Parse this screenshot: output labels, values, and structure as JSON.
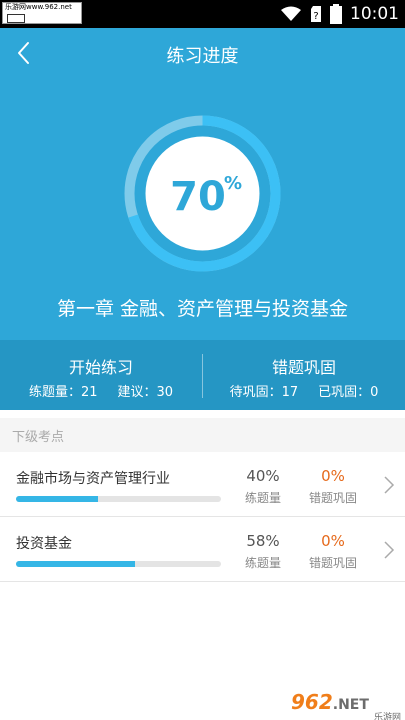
{
  "status_bar": {
    "watermark_text": "乐游网www.962.net",
    "time": "10:01",
    "battery_icon": "battery-icon",
    "wifi_icon": "wifi-icon"
  },
  "header": {
    "title": "练习进度",
    "back_icon": "back-chevron-icon"
  },
  "progress_ring": {
    "percent_value": "70",
    "percent_sign": "%",
    "progress": 0.7,
    "color_track": "#8fd3f0",
    "color_fill": "#3cc0f5"
  },
  "chapter": "第一章  金融、资产管理与投资基金",
  "practice": {
    "start": {
      "title": "开始练习",
      "stat1": "练题量：21",
      "stat2": "建议：30"
    },
    "review": {
      "title": "错题巩固",
      "stat1": "待巩固：17",
      "stat2": "已巩固：0"
    }
  },
  "sub_points_label": "下级考点",
  "rows": [
    {
      "name": "金融市场与资产管理行业",
      "progress": 0.4,
      "practice_value": "40%",
      "practice_label": "练题量",
      "error_value": "0%",
      "error_label": "错题巩固"
    },
    {
      "name": "投资基金",
      "progress": 0.58,
      "practice_value": "58%",
      "practice_label": "练题量",
      "error_value": "0%",
      "error_label": "错题巩固"
    }
  ],
  "watermark": {
    "num": "962",
    "net": ".NET",
    "cn": "乐游网"
  },
  "colors": {
    "hero": "#2ea7d8",
    "practice_bar": "#2596c4",
    "accent": "#35b6e6",
    "error_orange": "#e66a1c"
  }
}
